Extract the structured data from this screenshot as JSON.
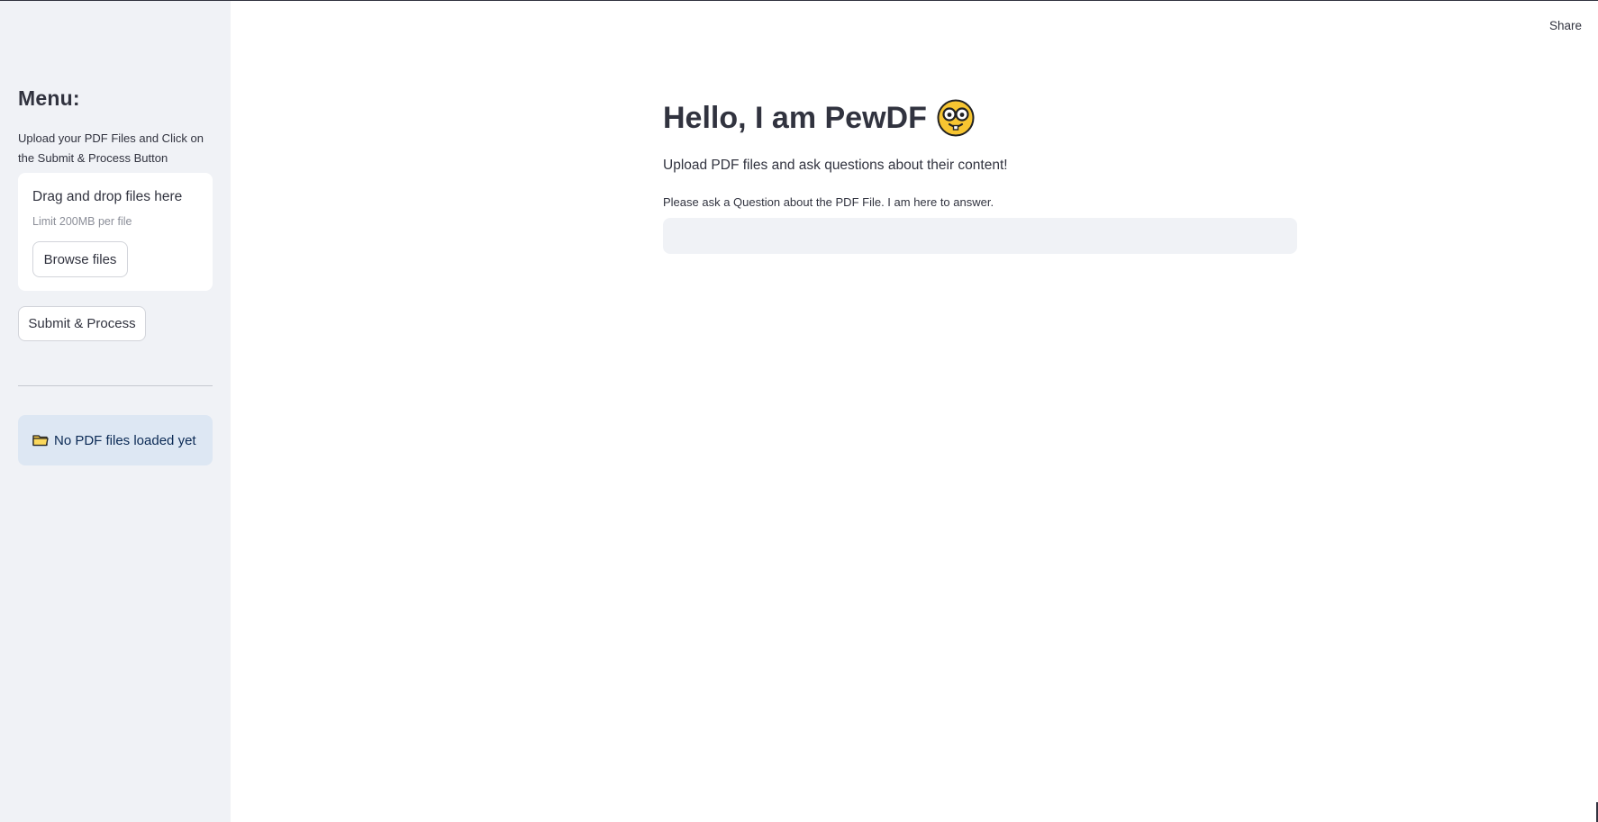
{
  "header": {
    "share_label": "Share"
  },
  "sidebar": {
    "title": "Menu:",
    "description": "Upload your PDF Files and Click on the Submit & Process Button",
    "uploader": {
      "drag_text": "Drag and drop files here",
      "limit_text": "Limit 200MB per file",
      "browse_label": "Browse files"
    },
    "submit_label": "Submit & Process",
    "status": {
      "icon": "folder-icon",
      "text": "No PDF files loaded yet"
    }
  },
  "main": {
    "title": "Hello, I am PewDF",
    "title_icon": "nerd-face-icon",
    "subtitle": "Upload PDF files and ask questions about their content!",
    "question_label": "Please ask a Question about the PDF File. I am here to answer.",
    "question_value": "",
    "question_placeholder": ""
  },
  "colors": {
    "sidebar_bg": "#f0f2f6",
    "info_bg": "#dde7f3",
    "input_bg": "#f0f2f6",
    "text": "#31333f"
  }
}
